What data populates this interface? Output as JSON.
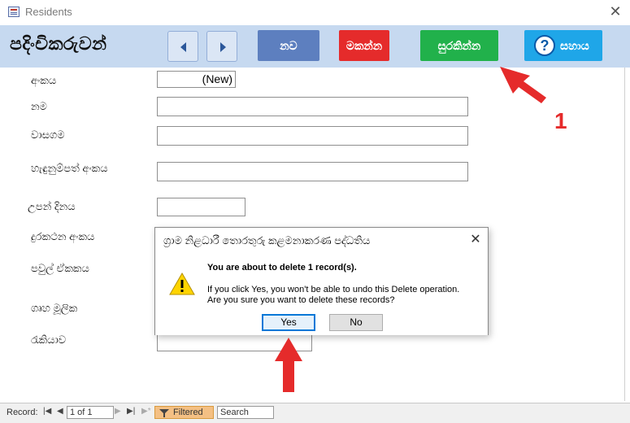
{
  "window": {
    "title": "Residents",
    "close_glyph": "✕"
  },
  "header": {
    "form_title": "පදිංචිකරුවන්",
    "buttons": {
      "new": "නව",
      "delete": "මකන්න",
      "save": "සුරකින්න",
      "help": "සහාය"
    }
  },
  "form": {
    "labels": {
      "number": "අංකය",
      "name": "නම",
      "residence": "වාසගම",
      "id_number": "හැඳුනුම්පත් අංකය",
      "birth_date": "උපන් දිනය",
      "phone": "දුරකථන අංකය",
      "family_unit": "පවුල් ඒකකය",
      "household_head": "ගෘහ මූලික",
      "occupation": "රැකියාව"
    },
    "values": {
      "number": "(New)"
    }
  },
  "dialog": {
    "title": "ග්‍රාම නිළධාරී තොරතුරු කළමනාකරණ පද්ධතිය",
    "heading": "You are about to delete 1 record(s).",
    "line1": "If you click Yes, you won't be able to undo this Delete operation.",
    "line2": "Are you sure you want to delete these records?",
    "yes": "Yes",
    "no": "No",
    "icon": "warning-icon"
  },
  "statusbar": {
    "record_label": "Record:",
    "position": "1 of 1",
    "filter": "Filtered",
    "search": "Search"
  },
  "annotations": {
    "step_number": "1"
  },
  "colors": {
    "header_bg": "#c6d9f0",
    "new_btn": "#5d7fbf",
    "delete_btn": "#e52b2b",
    "save_btn": "#21b14b",
    "help_btn": "#1fa6e8",
    "annotation": "#e52b2b"
  }
}
